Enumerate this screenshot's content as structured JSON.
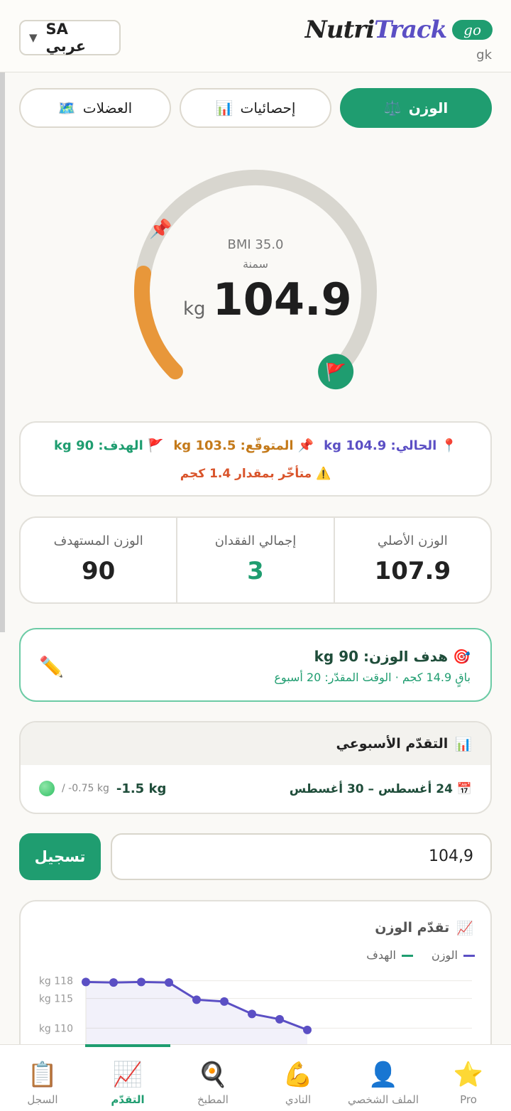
{
  "header": {
    "lang_flag": "SA",
    "lang_label": "عربي",
    "brand_part1": "Nutri",
    "brand_part2": "Track",
    "brand_badge": "go",
    "user_initials": "gk"
  },
  "tabs": [
    {
      "label": "الوزن",
      "icon": "⚖️",
      "active": true
    },
    {
      "label": "إحصائيات",
      "icon": "📊",
      "active": false
    },
    {
      "label": "العضلات",
      "icon": "🗺️",
      "active": false
    }
  ],
  "gauge": {
    "bmi_label": "BMI 35.0",
    "category": "سمنة",
    "unit": "kg",
    "weight": "104.9",
    "progress_fraction": 0.2,
    "expected_fraction": 0.17
  },
  "summary": {
    "current_icon": "📍",
    "current": "الحالي: 104.9 kg",
    "expected_icon": "📌",
    "expected": "المتوقّع: 103.5 kg",
    "goal_icon": "🚩",
    "goal": "الهدف: 90 kg",
    "late_icon": "⚠️",
    "late": "متأخّر بمقدار 1.4 كجم"
  },
  "stats": [
    {
      "label": "الوزن الأصلي",
      "value": "107.9"
    },
    {
      "label": "إجمالي الفقدان",
      "value": "3"
    },
    {
      "label": "الوزن المستهدف",
      "value": "90"
    }
  ],
  "goal_card": {
    "icon": "🎯",
    "title": "هدف الوزن: 90 kg",
    "subtitle": "باقٍ 14.9 كجم · الوقت المقدّر: 20 أسبوع"
  },
  "weekly": {
    "icon": "📊",
    "title": "التقدّم الأسبوعي",
    "range_icon": "📅",
    "range": "24 أغسطس – 30 أغسطس",
    "change": "-1.5 kg",
    "target": "/ -0.75 kg"
  },
  "entry": {
    "value": "104,9",
    "button": "تسجيل"
  },
  "chart_data": {
    "type": "line",
    "title": "تقدّم الوزن",
    "title_icon": "📈",
    "series": [
      {
        "name": "الوزن",
        "color": "#5b4fc4",
        "values": [
          117.8,
          117.7,
          117.8,
          117.7,
          114.8,
          114.5,
          112.4,
          111.5,
          109.7
        ]
      },
      {
        "name": "الهدف",
        "color": "#1f9d70",
        "values": []
      }
    ],
    "yticks": [
      "kg 118",
      "kg 115",
      "kg 110"
    ],
    "ylim": [
      105,
      120
    ]
  },
  "nav": [
    {
      "label": "السجل",
      "icon": "📋",
      "active": false
    },
    {
      "label": "التقدّم",
      "icon": "📈",
      "active": true
    },
    {
      "label": "المطبخ",
      "icon": "🍳",
      "active": false
    },
    {
      "label": "النادي",
      "icon": "💪",
      "active": false
    },
    {
      "label": "الملف الشخصي",
      "icon": "👤",
      "active": false
    },
    {
      "label": "Pro",
      "icon": "⭐",
      "active": false
    }
  ]
}
